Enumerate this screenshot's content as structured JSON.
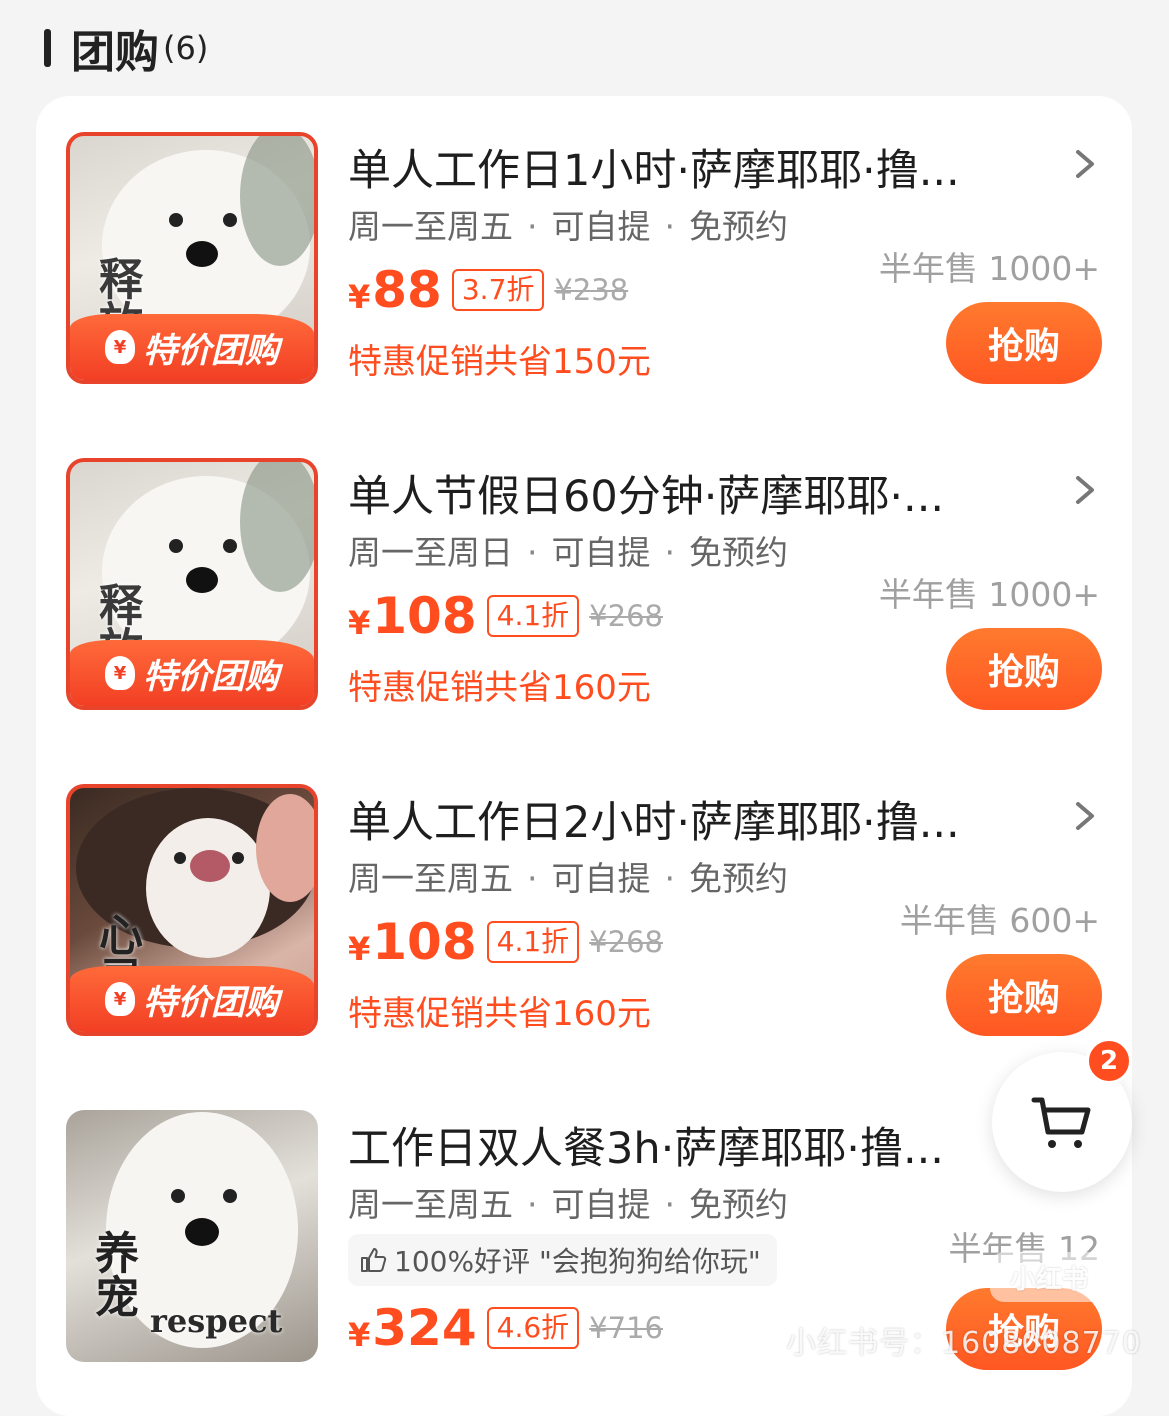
{
  "section": {
    "title": "团购",
    "count": "(6)"
  },
  "colors": {
    "accent": "#ff4d1f",
    "button": "#ff5722",
    "badge": "#f23f24"
  },
  "deals": [
    {
      "thumb_text": "释放",
      "badge": "特价团购",
      "name": "单人工作日1小时·萨摩耶耶·撸...",
      "meta": [
        "周一至周五",
        "可自提",
        "免预约"
      ],
      "sold": "半年售 1000+",
      "yen": "¥",
      "price": "88",
      "discount": "3.7折",
      "original": "¥238",
      "promo": "特惠促销共省150元",
      "buy": "抢购"
    },
    {
      "thumb_text": "释放",
      "badge": "特价团购",
      "name": "单人节假日60分钟·萨摩耶耶·...",
      "meta": [
        "周一至周日",
        "可自提",
        "免预约"
      ],
      "sold": "半年售 1000+",
      "yen": "¥",
      "price": "108",
      "discount": "4.1折",
      "original": "¥268",
      "promo": "特惠促销共省160元",
      "buy": "抢购"
    },
    {
      "thumb_text": "心灵",
      "badge": "特价团购",
      "name": "单人工作日2小时·萨摩耶耶·撸...",
      "meta": [
        "周一至周五",
        "可自提",
        "免预约"
      ],
      "sold": "半年售 600+",
      "yen": "¥",
      "price": "108",
      "discount": "4.1折",
      "original": "¥268",
      "promo": "特惠促销共省160元",
      "buy": "抢购"
    },
    {
      "thumb_text": "养宠",
      "thumb_en": "respect",
      "name": "工作日双人餐3h·萨摩耶耶·撸...",
      "meta": [
        "周一至周五",
        "可自提",
        "免预约"
      ],
      "review": "100%好评 \"会抱狗狗给你玩\"",
      "sold": "半年售 12",
      "yen": "¥",
      "price": "324",
      "discount": "4.6折",
      "original": "¥716",
      "buy": "抢购"
    }
  ],
  "cart": {
    "icon": "cart-icon",
    "count": "2"
  },
  "watermark": {
    "logo": "小红书",
    "text": "小红书号：1608008770"
  }
}
